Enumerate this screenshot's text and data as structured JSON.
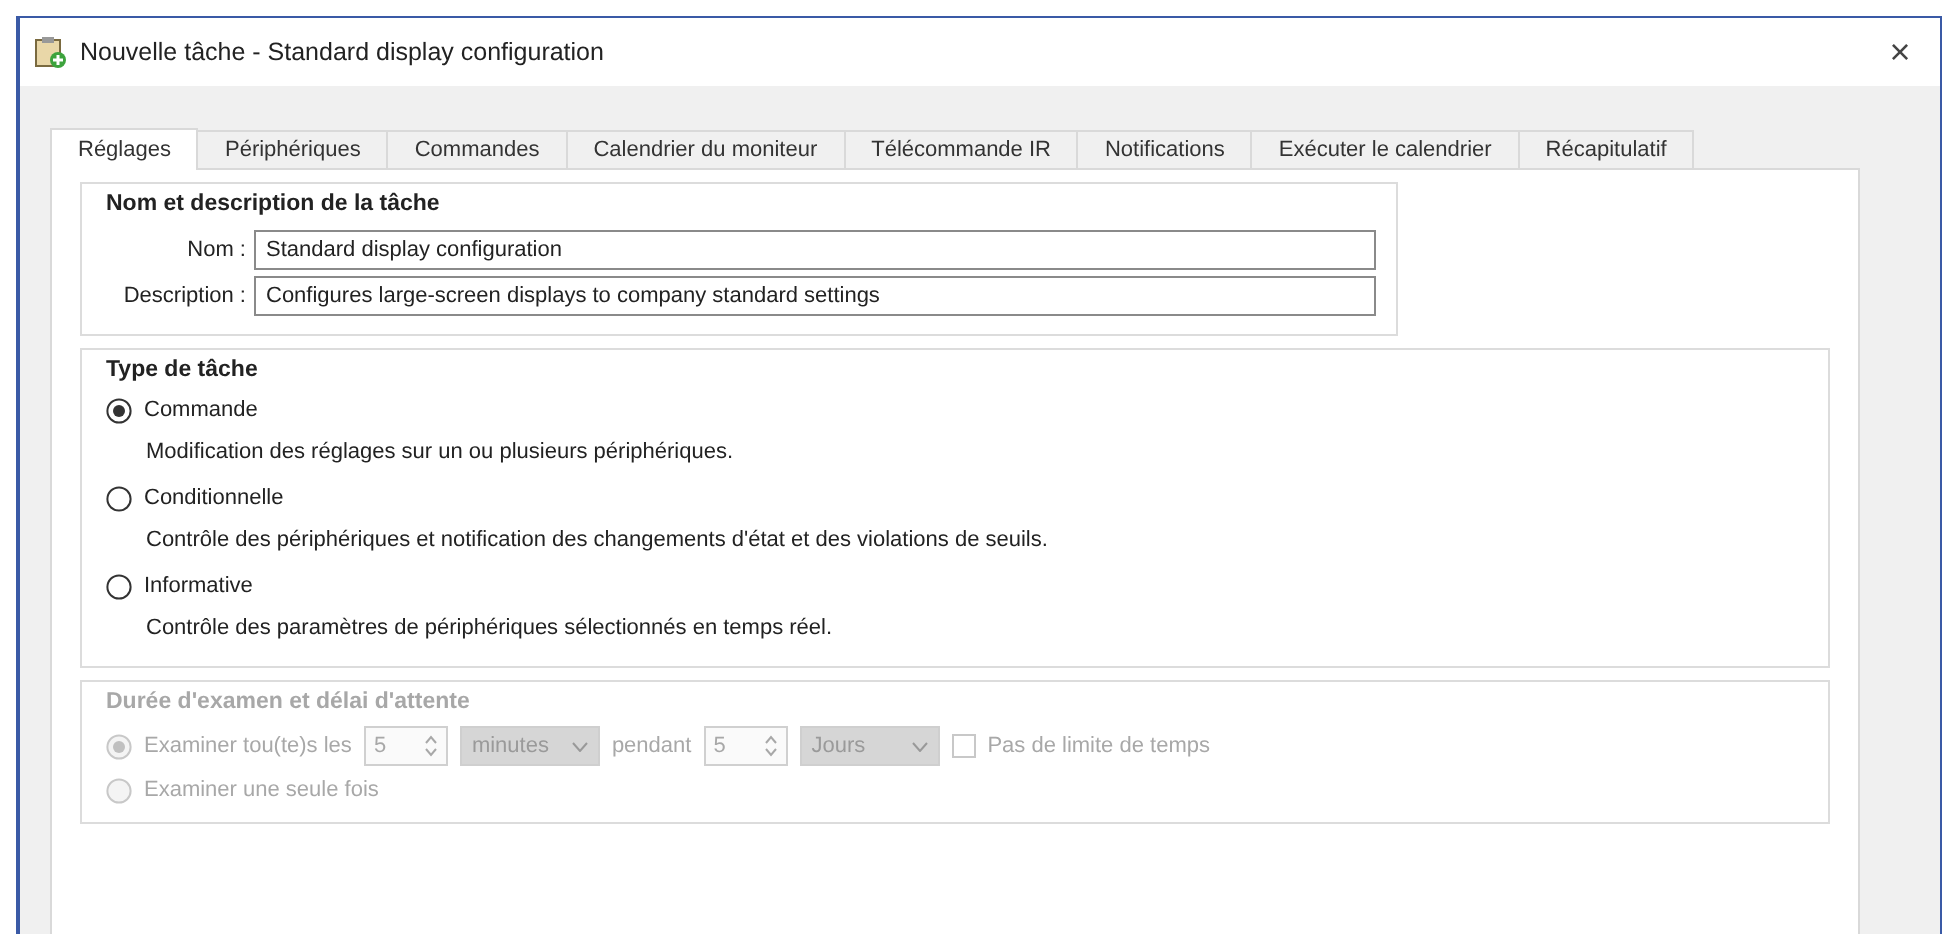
{
  "window": {
    "title": "Nouvelle tâche - Standard display configuration",
    "close": "×"
  },
  "tabs": [
    {
      "label": "Réglages",
      "selected": true
    },
    {
      "label": "Périphériques",
      "selected": false
    },
    {
      "label": "Commandes",
      "selected": false
    },
    {
      "label": "Calendrier du moniteur",
      "selected": false
    },
    {
      "label": "Télécommande IR",
      "selected": false
    },
    {
      "label": "Notifications",
      "selected": false
    },
    {
      "label": "Exécuter le calendrier",
      "selected": false
    },
    {
      "label": "Récapitulatif",
      "selected": false
    }
  ],
  "name_group": {
    "title": "Nom et description de la tâche",
    "fields": [
      {
        "label": "Nom :",
        "value": "Standard display configuration"
      },
      {
        "label": "Description :",
        "value": "Configures large-screen displays to company standard settings"
      }
    ]
  },
  "task_type": {
    "title": "Type de tâche",
    "options": [
      {
        "label": "Commande",
        "description": "Modification des réglages sur un ou plusieurs périphériques.",
        "selected": true
      },
      {
        "label": "Conditionnelle",
        "description": "Contrôle des périphériques et notification des changements d'état et des violations de seuils.",
        "selected": false
      },
      {
        "label": "Informative",
        "description": "Contrôle des paramètres de périphériques sélectionnés en temps réel.",
        "selected": false
      }
    ]
  },
  "scan": {
    "title": "Durée d'examen et délai d'attente",
    "disabled": true,
    "options": [
      {
        "label": "Examiner tou(te)s les",
        "selected": true
      },
      {
        "label": "Examiner une seule fois",
        "selected": false
      }
    ],
    "interval": {
      "value": "5",
      "unit": "minutes"
    },
    "duration_label": "pendant",
    "duration": {
      "value": "5",
      "unit": "Jours"
    },
    "no_limit": {
      "label": "Pas de limite de temps",
      "checked": false
    }
  }
}
